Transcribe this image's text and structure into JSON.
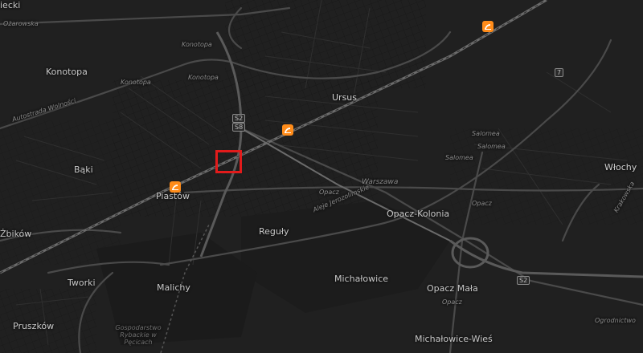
{
  "map": {
    "theme": "dark",
    "colors": {
      "background": "#202020",
      "major_road": "#4a4a4a",
      "railway": "#6b6b6b",
      "station": "#ff8c1a",
      "selection": "#e21b1b"
    },
    "towns": [
      "Ursus",
      "Piastów",
      "Bąki",
      "Konotopa",
      "Reguły",
      "Malichy",
      "Michałowice",
      "Opacz-Kolonia",
      "Opacz Mała",
      "Włochy",
      "Pruszków",
      "Tworki",
      "Michałowice-Wieś",
      "Żbików"
    ],
    "street_labels": [
      "Konotopa",
      "Konotopa",
      "Konotopa",
      "Autostrada Wolności",
      "Aleje Jerozolimskie",
      "Warszawa",
      "Opacz",
      "Opacz",
      "Opacz",
      "Salomea",
      "Salomea",
      "Salomea",
      "Krakowska",
      "Ożarowska",
      "Ogrodnictwo",
      "Gospodarstwo Rybackie w Pęcicach"
    ],
    "road_shields": [
      "S2",
      "S8",
      "S2",
      "7"
    ],
    "partial_label": "iecki",
    "stations": [
      "train-station",
      "train-station",
      "train-station"
    ],
    "selection_marker": "red-square"
  }
}
